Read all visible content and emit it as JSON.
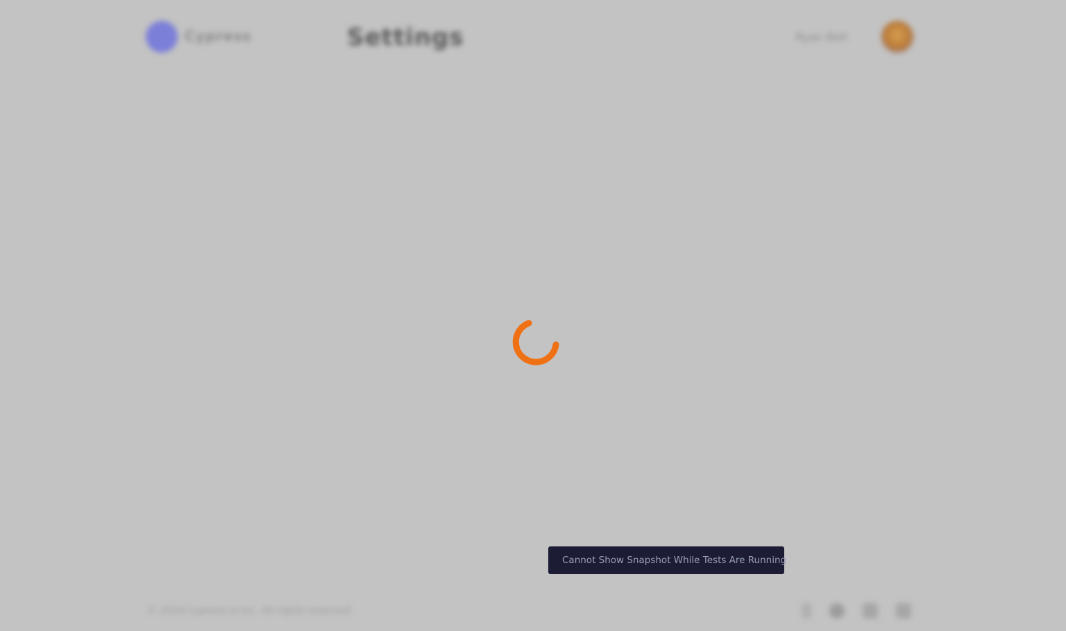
{
  "header": {
    "logo_text": "Cypress",
    "page_heading": "Settings",
    "user_name": "Ryan Bell"
  },
  "footer": {
    "copyright": "© 2024 Cypress.io Inc. All rights reserved",
    "icons": [
      "help-icon",
      "chat-icon",
      "mail-icon",
      "twitter-icon"
    ]
  },
  "loading": {
    "spinner_color": "#f07014"
  },
  "toast": {
    "message": "Cannot Show Snapshot While Tests Are Running",
    "icon": "pin-icon",
    "icon_color": "#b366e6"
  }
}
